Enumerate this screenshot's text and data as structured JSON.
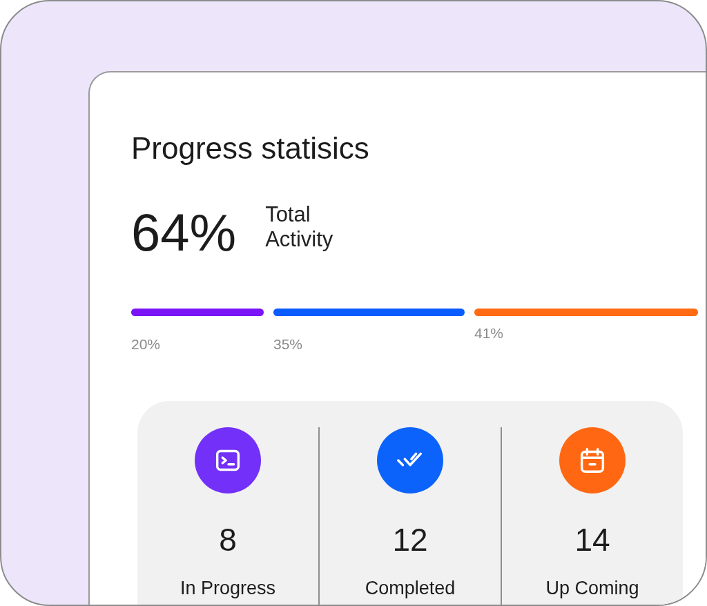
{
  "title": "Progress statisics",
  "total": {
    "value": "64%",
    "label_lines": [
      "Total",
      "Activity"
    ]
  },
  "segments": [
    {
      "percent": "20%",
      "color": "#7a14f7"
    },
    {
      "percent": "35%",
      "color": "#0b5cff"
    },
    {
      "percent": "41%",
      "color": "#ff6a13"
    }
  ],
  "stats": [
    {
      "count": "8",
      "label": "In Progress",
      "color": "#7330f8"
    },
    {
      "count": "12",
      "label": "Completed",
      "color": "#0b63fb"
    },
    {
      "count": "14",
      "label": "Up Coming",
      "color": "#ff6712"
    }
  ]
}
